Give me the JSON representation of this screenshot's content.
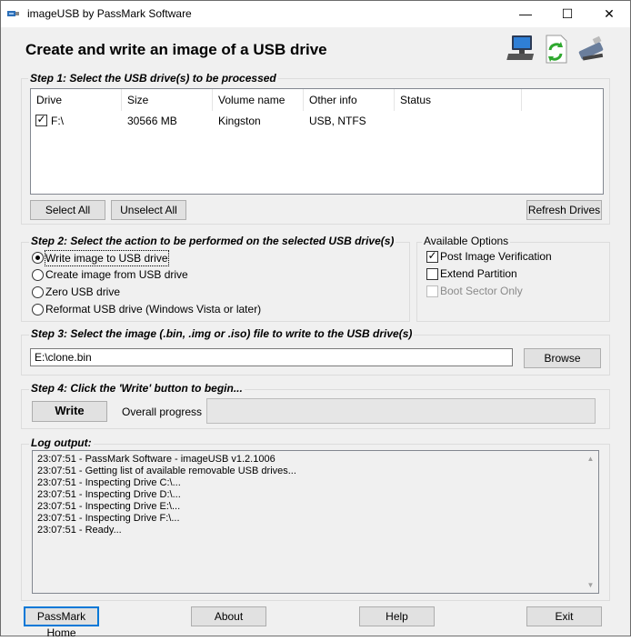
{
  "window": {
    "title": "imageUSB by PassMark Software",
    "min": "—",
    "max": "☐",
    "close": "✕"
  },
  "heading": "Create and write an image of a USB drive",
  "step1": {
    "label": "Step 1:  Select the USB drive(s) to be processed",
    "columns": [
      "Drive",
      "Size",
      "Volume name",
      "Other info",
      "Status"
    ],
    "rows": [
      {
        "checked": true,
        "drive": "F:\\",
        "size": "30566 MB",
        "volume": "Kingston",
        "info": "USB, NTFS",
        "status": ""
      }
    ],
    "select_all": "Select All",
    "unselect_all": "Unselect All",
    "refresh": "Refresh Drives"
  },
  "step2": {
    "label": "Step 2: Select the action to be performed on the selected USB drive(s)",
    "options": [
      {
        "label": "Write image to USB drive",
        "selected": true
      },
      {
        "label": "Create image from USB drive",
        "selected": false
      },
      {
        "label": "Zero USB drive",
        "selected": false
      },
      {
        "label": "Reformat USB drive (Windows Vista or later)",
        "selected": false
      }
    ]
  },
  "available": {
    "label": "Available Options",
    "options": [
      {
        "label": "Post Image Verification",
        "checked": true,
        "enabled": true
      },
      {
        "label": "Extend Partition",
        "checked": false,
        "enabled": true
      },
      {
        "label": "Boot Sector Only",
        "checked": false,
        "enabled": false
      }
    ]
  },
  "step3": {
    "label": "Step 3: Select the image (.bin, .img or .iso) file to write to the USB drive(s)",
    "path": "E:\\clone.bin",
    "browse": "Browse"
  },
  "step4": {
    "label": "Step 4: Click the 'Write' button to begin...",
    "write": "Write",
    "progress_label": "Overall progress",
    "progress": 0
  },
  "log": {
    "label": "Log output:",
    "lines": [
      "23:07:51 - PassMark Software - imageUSB v1.2.1006",
      "23:07:51 - Getting list of available removable USB drives...",
      "23:07:51 - Inspecting Drive C:\\...",
      "23:07:51 - Inspecting Drive D:\\...",
      "23:07:51 - Inspecting Drive E:\\...",
      "23:07:51 - Inspecting Drive F:\\...",
      "23:07:51 - Ready..."
    ]
  },
  "footer": {
    "home": "PassMark Home",
    "about": "About",
    "help": "Help",
    "exit": "Exit"
  },
  "icons": [
    "computer-icon",
    "refresh-document-icon",
    "usb-drive-icon",
    "close-icon",
    "maximize-icon",
    "minimize-icon",
    "app-icon"
  ],
  "colors": {
    "focus_border": "#0078d7",
    "window_bg": "#f0f0f0"
  }
}
